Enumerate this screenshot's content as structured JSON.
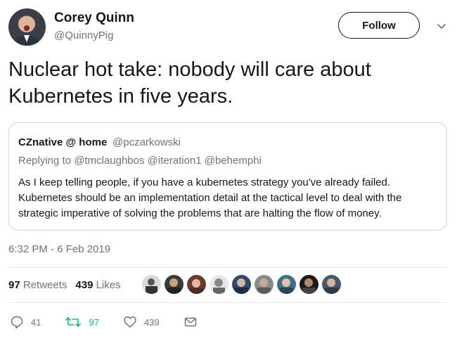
{
  "author": {
    "name": "Corey Quinn",
    "handle": "@QuinnyPig",
    "avatar_icon": "user-avatar"
  },
  "follow_label": "Follow",
  "tweet_text": "Nuclear hot take: nobody will care about Kubernetes in five years.",
  "quoted_tweet": {
    "name": "CZnative @ home",
    "handle": "@pczarkowski",
    "reply_prefix": "Replying to",
    "reply_mentions": "@tmclaughbos @iteration1 @behemphi",
    "body": "As I keep telling people, if you have a kubernetes strategy you've already failed. Kubernetes should be an implementation detail at the tactical level to deal with the strategic imperative of solving the problems that are halting the flow of money."
  },
  "timestamp": "6:32 PM - 6 Feb 2019",
  "stats": {
    "retweets_count": "97",
    "retweets_label": "Retweets",
    "likes_count": "439",
    "likes_label": "Likes"
  },
  "likers_count": 9,
  "actions": {
    "reply_count": "41",
    "retweet_count": "97",
    "like_count": "439"
  },
  "colors": {
    "retweet_green": "#17bf63",
    "secondary_text": "#657786",
    "border": "#ccd6dd"
  }
}
